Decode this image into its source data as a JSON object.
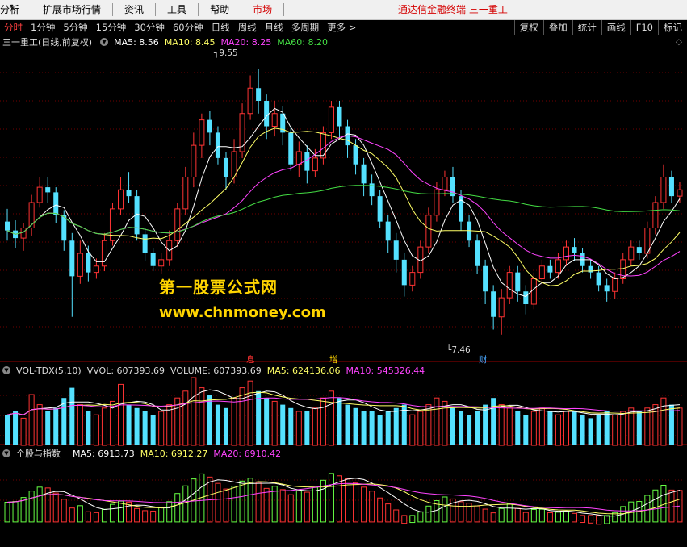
{
  "menu": {
    "items": [
      "分析",
      "扩展市场行情",
      "资讯",
      "工具",
      "帮助"
    ],
    "market": "市场",
    "right_title": "通达信金融终端  三一重工"
  },
  "toolbar": {
    "periods": [
      "分时",
      "1分钟",
      "5分钟",
      "15分钟",
      "30分钟",
      "60分钟",
      "日线",
      "周线",
      "月线",
      "多周期",
      "更多 >"
    ],
    "active_index": 0,
    "right_buttons": [
      "复权",
      "叠加",
      "统计",
      "画线",
      "F10",
      "标记"
    ]
  },
  "main_legend": {
    "title": "三一重工(日线,前复权)",
    "ma5": "MA5: 8.56",
    "ma10": "MA10: 8.45",
    "ma20": "MA20: 8.25",
    "ma60": "MA60: 8.20"
  },
  "price_labels": {
    "high": "9.55",
    "low": "7.46"
  },
  "event_markers": [
    {
      "text": "息",
      "color": "#ff3333"
    },
    {
      "text": "增",
      "color": "#ffd400"
    },
    {
      "text": "财",
      "color": "#4aa8ff"
    }
  ],
  "vol_legend": {
    "title": "VOL-TDX(5,10)",
    "vvol": "VVOL: 607393.69",
    "volume": "VOLUME: 607393.69",
    "ma5": "MA5: 624136.06",
    "ma10": "MA10: 545326.44"
  },
  "ind_legend": {
    "title": "个股与指数",
    "ma5": "MA5: 6913.73",
    "ma10": "MA10: 6912.27",
    "ma20": "MA20: 6910.42"
  },
  "watermark": {
    "line1": "第一股票公式网",
    "line2": "www.chnmoney.com"
  },
  "colors": {
    "up": "#ff3333",
    "down": "#54e1ff",
    "ma5": "#ffffff",
    "ma10": "#ffff66",
    "ma20": "#ff44ff",
    "ma60": "#44dd44",
    "grid": "#700000"
  },
  "price_range": [
    7.3,
    9.7
  ],
  "chart_data": {
    "type": "candlestick",
    "price_high_label": 9.55,
    "price_low_label": 7.46,
    "last_ma": {
      "ma5": 8.56,
      "ma10": 8.45,
      "ma20": 8.25,
      "ma60": 8.2
    },
    "candles": [
      [
        8.35,
        8.28,
        8.45,
        8.2
      ],
      [
        8.28,
        8.22,
        8.36,
        8.14
      ],
      [
        8.22,
        8.3,
        8.34,
        8.12
      ],
      [
        8.3,
        8.5,
        8.56,
        8.24
      ],
      [
        8.5,
        8.62,
        8.7,
        8.46
      ],
      [
        8.62,
        8.58,
        8.7,
        8.5
      ],
      [
        8.58,
        8.4,
        8.62,
        8.34
      ],
      [
        8.4,
        8.2,
        8.44,
        8.12
      ],
      [
        8.2,
        7.92,
        8.26,
        7.6
      ],
      [
        7.92,
        8.1,
        8.2,
        7.86
      ],
      [
        8.1,
        7.95,
        8.16,
        7.88
      ],
      [
        7.95,
        8.0,
        8.06,
        7.9
      ],
      [
        8.0,
        8.2,
        8.26,
        7.96
      ],
      [
        8.2,
        8.45,
        8.5,
        8.16
      ],
      [
        8.45,
        8.6,
        8.7,
        8.4
      ],
      [
        8.6,
        8.55,
        8.74,
        8.5
      ],
      [
        8.55,
        8.25,
        8.6,
        8.2
      ],
      [
        8.25,
        8.1,
        8.3,
        8.04
      ],
      [
        8.1,
        8.0,
        8.14,
        7.96
      ],
      [
        8.0,
        8.05,
        8.1,
        7.94
      ],
      [
        8.05,
        8.2,
        8.28,
        8.0
      ],
      [
        8.2,
        8.45,
        8.5,
        8.15
      ],
      [
        8.45,
        8.7,
        8.78,
        8.4
      ],
      [
        8.7,
        8.95,
        9.05,
        8.62
      ],
      [
        8.95,
        9.15,
        9.2,
        8.85
      ],
      [
        9.15,
        9.05,
        9.22,
        8.95
      ],
      [
        9.05,
        8.85,
        9.1,
        8.8
      ],
      [
        8.85,
        8.7,
        8.9,
        8.6
      ],
      [
        8.7,
        8.9,
        9.0,
        8.65
      ],
      [
        8.9,
        9.2,
        9.28,
        8.85
      ],
      [
        9.2,
        9.4,
        9.5,
        9.15
      ],
      [
        9.4,
        9.3,
        9.55,
        9.2
      ],
      [
        9.3,
        9.1,
        9.35,
        9.0
      ],
      [
        9.1,
        9.2,
        9.3,
        9.02
      ],
      [
        9.2,
        9.05,
        9.26,
        8.95
      ],
      [
        9.05,
        8.8,
        9.1,
        8.75
      ],
      [
        8.8,
        8.9,
        8.98,
        8.7
      ],
      [
        8.9,
        8.75,
        8.95,
        8.65
      ],
      [
        8.75,
        8.85,
        8.92,
        8.7
      ],
      [
        8.85,
        9.05,
        9.1,
        8.8
      ],
      [
        9.05,
        9.25,
        9.3,
        9.0
      ],
      [
        9.25,
        9.1,
        9.3,
        9.0
      ],
      [
        9.1,
        8.95,
        9.15,
        8.85
      ],
      [
        8.95,
        8.8,
        9.0,
        8.72
      ],
      [
        8.8,
        8.65,
        8.85,
        8.55
      ],
      [
        8.65,
        8.55,
        8.72,
        8.48
      ],
      [
        8.55,
        8.35,
        8.6,
        8.3
      ],
      [
        8.35,
        8.2,
        8.4,
        8.1
      ],
      [
        8.2,
        8.05,
        8.26,
        7.95
      ],
      [
        8.05,
        7.85,
        8.1,
        7.76
      ],
      [
        7.85,
        7.95,
        8.0,
        7.8
      ],
      [
        7.95,
        8.15,
        8.2,
        7.9
      ],
      [
        8.15,
        8.4,
        8.46,
        8.1
      ],
      [
        8.4,
        8.6,
        8.66,
        8.35
      ],
      [
        8.6,
        8.7,
        8.75,
        8.55
      ],
      [
        8.7,
        8.55,
        8.78,
        8.5
      ],
      [
        8.55,
        8.35,
        8.6,
        8.28
      ],
      [
        8.35,
        8.2,
        8.4,
        8.15
      ],
      [
        8.2,
        8.0,
        8.25,
        7.94
      ],
      [
        8.0,
        7.8,
        8.05,
        7.7
      ],
      [
        7.8,
        7.6,
        7.85,
        7.5
      ],
      [
        7.6,
        7.75,
        7.82,
        7.46
      ],
      [
        7.75,
        7.95,
        8.0,
        7.7
      ],
      [
        7.95,
        7.8,
        8.0,
        7.72
      ],
      [
        7.8,
        7.7,
        7.85,
        7.62
      ],
      [
        7.7,
        7.9,
        7.95,
        7.66
      ],
      [
        7.9,
        8.0,
        8.05,
        7.85
      ],
      [
        8.0,
        7.95,
        8.05,
        7.9
      ],
      [
        7.95,
        8.05,
        8.1,
        7.9
      ],
      [
        8.05,
        8.15,
        8.2,
        8.0
      ],
      [
        8.15,
        8.1,
        8.22,
        8.04
      ],
      [
        8.1,
        8.0,
        8.14,
        7.95
      ],
      [
        8.0,
        7.95,
        8.05,
        7.9
      ],
      [
        7.95,
        7.85,
        8.0,
        7.8
      ],
      [
        7.85,
        7.8,
        7.9,
        7.72
      ],
      [
        7.8,
        7.9,
        7.95,
        7.74
      ],
      [
        7.9,
        8.05,
        8.1,
        7.86
      ],
      [
        8.05,
        8.15,
        8.2,
        8.0
      ],
      [
        8.15,
        8.1,
        8.2,
        8.05
      ],
      [
        8.1,
        8.3,
        8.35,
        8.06
      ],
      [
        8.3,
        8.5,
        8.55,
        8.25
      ],
      [
        8.5,
        8.7,
        8.8,
        8.45
      ],
      [
        8.7,
        8.55,
        8.75,
        8.5
      ],
      [
        8.55,
        8.6,
        8.66,
        8.5
      ]
    ],
    "volume": [
      0.45,
      0.5,
      0.4,
      0.75,
      0.6,
      0.5,
      0.55,
      0.7,
      0.85,
      0.6,
      0.5,
      0.45,
      0.55,
      0.65,
      0.9,
      0.6,
      0.55,
      0.5,
      0.45,
      0.5,
      0.6,
      0.7,
      0.8,
      1.0,
      0.85,
      0.75,
      0.6,
      0.55,
      0.7,
      0.85,
      0.95,
      0.8,
      0.7,
      0.65,
      0.6,
      0.55,
      0.5,
      0.5,
      0.55,
      0.7,
      0.8,
      0.7,
      0.6,
      0.55,
      0.5,
      0.5,
      0.45,
      0.5,
      0.55,
      0.6,
      0.45,
      0.5,
      0.6,
      0.7,
      0.65,
      0.55,
      0.5,
      0.45,
      0.5,
      0.6,
      0.7,
      0.6,
      0.55,
      0.5,
      0.45,
      0.5,
      0.55,
      0.5,
      0.45,
      0.5,
      0.5,
      0.45,
      0.4,
      0.45,
      0.5,
      0.45,
      0.5,
      0.55,
      0.5,
      0.55,
      0.6,
      0.7,
      0.6,
      0.55
    ]
  }
}
